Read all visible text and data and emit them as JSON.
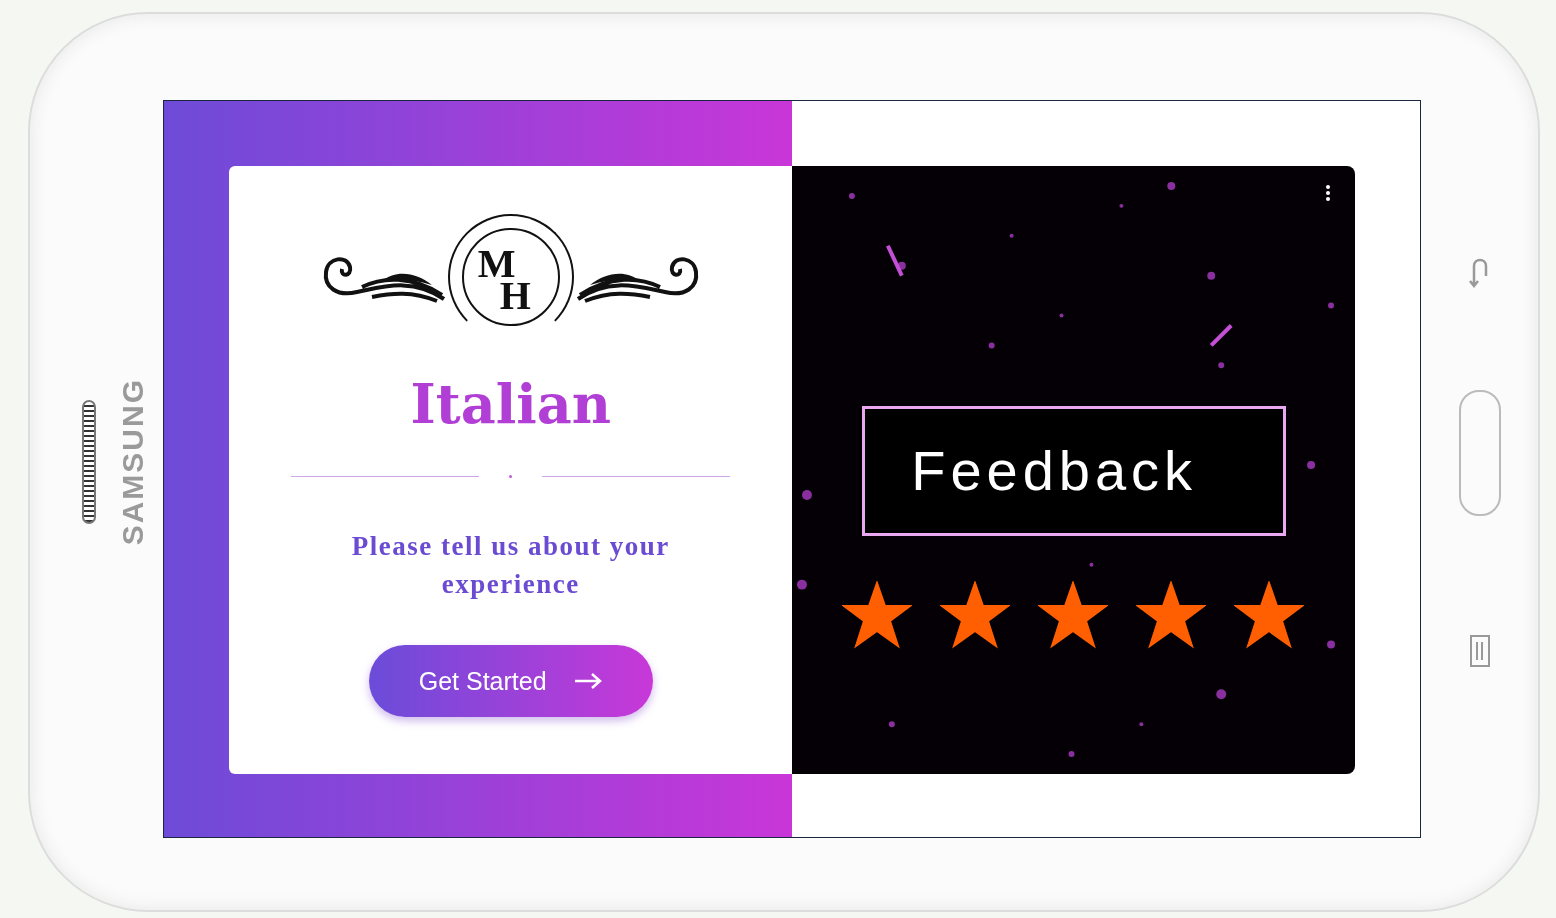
{
  "device": {
    "brand": "SAMSUNG"
  },
  "logo": {
    "initials": [
      "M",
      "H"
    ]
  },
  "title": "Italian",
  "prompt": "Please tell us about your experience",
  "button": {
    "label": "Get Started"
  },
  "feedback": {
    "title": "Feedback",
    "stars": 5
  }
}
